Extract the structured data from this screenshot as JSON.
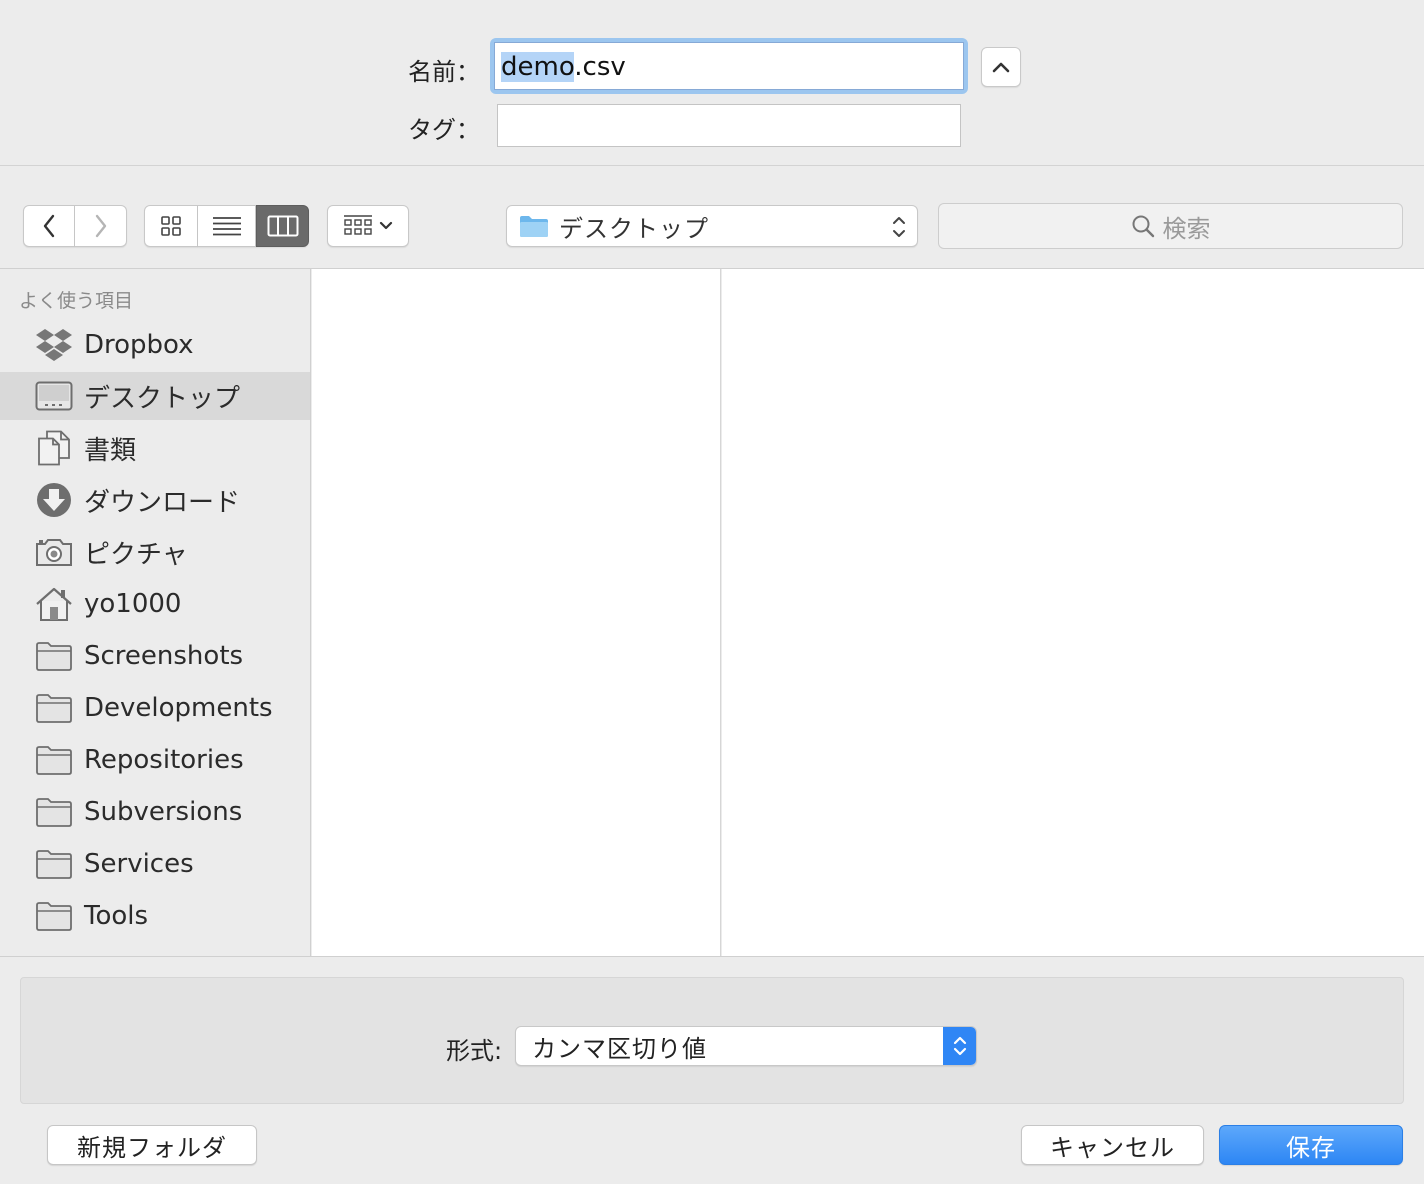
{
  "top": {
    "name_label": "名前：",
    "tag_label": "タグ：",
    "filename_selected": "demo",
    "filename_rest": ".csv",
    "tag_value": ""
  },
  "toolbar": {
    "location": "デスクトップ",
    "search_placeholder": "検索"
  },
  "sidebar": {
    "section_title": "よく使う項目",
    "items": [
      {
        "label": "Dropbox",
        "icon": "dropbox-icon",
        "selected": false
      },
      {
        "label": "デスクトップ",
        "icon": "desktop-icon",
        "selected": true
      },
      {
        "label": "書類",
        "icon": "documents-icon",
        "selected": false
      },
      {
        "label": "ダウンロード",
        "icon": "download-icon",
        "selected": false
      },
      {
        "label": "ピクチャ",
        "icon": "camera-icon",
        "selected": false
      },
      {
        "label": "yo1000",
        "icon": "home-icon",
        "selected": false
      },
      {
        "label": "Screenshots",
        "icon": "folder-icon",
        "selected": false
      },
      {
        "label": "Developments",
        "icon": "folder-icon",
        "selected": false
      },
      {
        "label": "Repositories",
        "icon": "folder-icon",
        "selected": false
      },
      {
        "label": "Subversions",
        "icon": "folder-icon",
        "selected": false
      },
      {
        "label": "Services",
        "icon": "folder-icon",
        "selected": false
      },
      {
        "label": "Tools",
        "icon": "folder-icon",
        "selected": false
      }
    ]
  },
  "format": {
    "label": "形式:",
    "value": "カンマ区切り値"
  },
  "buttons": {
    "new_folder": "新規フォルダ",
    "cancel": "キャンセル",
    "save": "保存"
  },
  "colors": {
    "accent": "#2f86f5",
    "selection_highlight": "#b4d4f7",
    "sidebar_selected": "#d9d9d9"
  }
}
